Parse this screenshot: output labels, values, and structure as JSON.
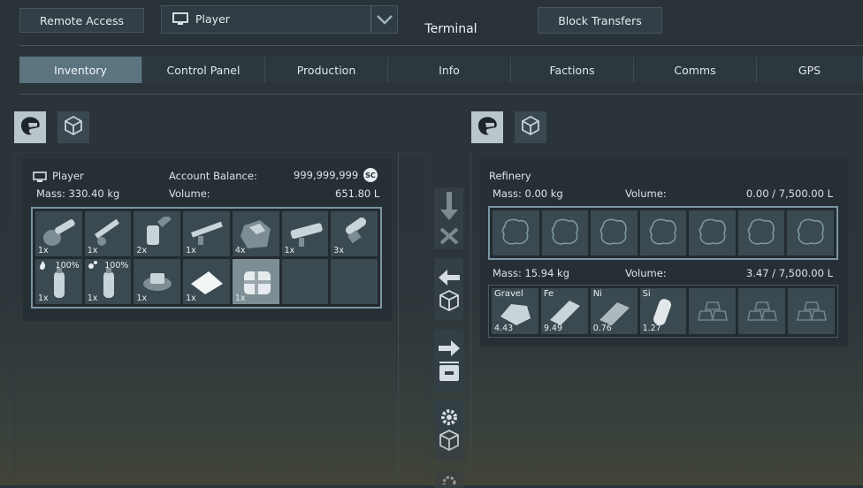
{
  "header": {
    "remote_access": "Remote Access",
    "grid_selector": "Player",
    "title": "Terminal",
    "block_transfers": "Block Transfers"
  },
  "tabs": [
    {
      "label": "Inventory",
      "active": true
    },
    {
      "label": "Control Panel",
      "active": false
    },
    {
      "label": "Production",
      "active": false
    },
    {
      "label": "Info",
      "active": false
    },
    {
      "label": "Factions",
      "active": false
    },
    {
      "label": "Comms",
      "active": false
    },
    {
      "label": "GPS",
      "active": false
    }
  ],
  "left": {
    "owner": "Player",
    "account_label": "Account Balance:",
    "balance": "999,999,999",
    "currency": "SC",
    "mass": "Mass: 330.40 kg",
    "volume_label": "Volume:",
    "volume": "651.80 L",
    "items": [
      {
        "icon": "grinder-icon",
        "count": "1x"
      },
      {
        "icon": "welder-icon",
        "count": "1x"
      },
      {
        "icon": "hand-drill-icon",
        "count": "2x"
      },
      {
        "icon": "rifle-icon",
        "count": "1x"
      },
      {
        "icon": "ore-chunk-icon",
        "count": "4x"
      },
      {
        "icon": "rocket-launcher-icon",
        "count": "1x"
      },
      {
        "icon": "missile-icon",
        "count": "3x"
      },
      {
        "icon": "hydrogen-bottle-icon",
        "count": "1x",
        "pct": "100%",
        "symbol": "flame"
      },
      {
        "icon": "oxygen-bottle-icon",
        "count": "1x",
        "pct": "100%",
        "symbol": "bubbles"
      },
      {
        "icon": "datapad-icon",
        "count": "1x"
      },
      {
        "icon": "space-credit-icon",
        "count": "1x"
      },
      {
        "icon": "component-crate-icon",
        "count": "1x",
        "highlight": true
      },
      {
        "icon": "empty-slot",
        "count": ""
      },
      {
        "icon": "empty-slot",
        "count": ""
      }
    ]
  },
  "right": {
    "name": "Refinery",
    "input_mass": "Mass: 0.00 kg",
    "input_volume_label": "Volume:",
    "input_volume": "0.00 / 7,500.00 L",
    "output_mass": "Mass: 15.94 kg",
    "output_volume_label": "Volume:",
    "output_volume": "3.47 / 7,500.00 L",
    "ingots": [
      {
        "symbol": "Gravel",
        "amount": "4.43",
        "icon": "gravel-icon"
      },
      {
        "symbol": "Fe",
        "amount": "9.49",
        "icon": "iron-ingot-icon"
      },
      {
        "symbol": "Ni",
        "amount": "0.76",
        "icon": "nickel-ingot-icon"
      },
      {
        "symbol": "Si",
        "amount": "1.27",
        "icon": "silicon-wafer-icon"
      },
      {
        "symbol": "",
        "amount": "",
        "icon": "ingot-placeholder-icon"
      },
      {
        "symbol": "",
        "amount": "",
        "icon": "ingot-placeholder-icon"
      },
      {
        "symbol": "",
        "amount": "",
        "icon": "ingot-placeholder-icon"
      }
    ]
  },
  "colors": {
    "accent": "#5b7480",
    "grid_border": "#7a96a2",
    "panel": "#262f34"
  }
}
